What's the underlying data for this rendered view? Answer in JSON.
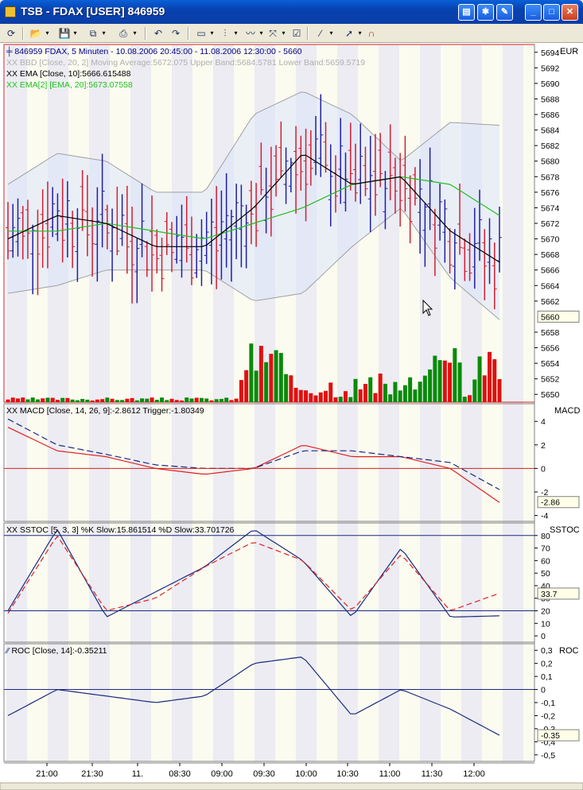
{
  "window": {
    "title": "TSB - FDAX [USER] 846959"
  },
  "panels": {
    "price": {
      "header": "846959  FDAX, 5 Minuten - 10.08.2006 20:45:00 - 11.08.2006 12:30:00 - 5660",
      "bbd": "XX BBD [Close, 20, 2] Moving Average:5672.075 Upper Band:5684.5781 Lower Band:5659.5719",
      "ema": "XX EMA [Close, 10]:5666.615488",
      "ema2": "XX EMA[2] [EMA, 20]:5673.07558",
      "right_label": "EUR",
      "last_value": "5660",
      "ticks": [
        "5694",
        "5692",
        "5690",
        "5688",
        "5686",
        "5684",
        "5682",
        "5680",
        "5678",
        "5676",
        "5674",
        "5672",
        "5670",
        "5668",
        "5666",
        "5664",
        "5662",
        "5658",
        "5656",
        "5654",
        "5652",
        "5650"
      ]
    },
    "macd": {
      "header": "XX MACD [Close, 14, 26, 9]:-2.8612 Trigger:-1.80349",
      "right_label": "MACD",
      "last_value": "-2.86",
      "ticks": [
        "4",
        "2",
        "0",
        "-2",
        "-4"
      ]
    },
    "sstoc": {
      "header": "XX SSTOC [5, 3, 3] %K Slow:15.861514 %D Slow:33.701726",
      "right_label": "SSTOC",
      "last_value": "33.7",
      "ticks": [
        "80",
        "70",
        "60",
        "50",
        "40",
        "30",
        "20",
        "10",
        "0"
      ]
    },
    "roc": {
      "header": "ROC [Close, 14]:-0.35211",
      "right_label": "ROC",
      "last_value": "-0.35",
      "ticks": [
        "0,3",
        "0,2",
        "0,1",
        "0",
        "-0,1",
        "-0,2",
        "-0,3",
        "-0,4",
        "-0,5"
      ]
    }
  },
  "time_axis": [
    "21:00",
    "21:30",
    "11.",
    "08:30",
    "09:00",
    "09:30",
    "10:00",
    "10:30",
    "11:00",
    "11:30",
    "12:00"
  ],
  "colors": {
    "up_candle": "#2020a0",
    "down_candle": "#d02030",
    "ema": "#000000",
    "ema2": "#20c020",
    "band": "#a0a0a0",
    "macd_line": "#e02020",
    "macd_trigger": "#1a2a80",
    "stoch_k": "#1a2a80",
    "stoch_d": "#e02020",
    "roc_line": "#1a2a80",
    "volume_up": "#0a8a0a",
    "volume_down": "#e01010"
  },
  "chart_data": [
    {
      "type": "line",
      "title": "846959  FDAX, 5 Minuten - 10.08.2006 20:45:00 - 11.08.2006 12:30:00 - 5660",
      "ylabel": "EUR",
      "ylim": [
        5649,
        5695
      ],
      "x": [
        "21:00",
        "21:30",
        "11.",
        "08:30",
        "09:00",
        "09:30",
        "10:00",
        "10:30",
        "11:00",
        "11:30",
        "12:00"
      ],
      "series": [
        {
          "name": "XX EMA [Close, 10]",
          "values": [
            5670,
            5673,
            5672,
            5669,
            5669,
            5674,
            5681,
            5677,
            5678,
            5671,
            5667
          ]
        },
        {
          "name": "XX EMA[2] [EMA, 20]",
          "values": [
            5671,
            5671,
            5672,
            5671,
            5670,
            5672,
            5674,
            5677,
            5678,
            5677,
            5673
          ]
        },
        {
          "name": "XX BBD Upper Band",
          "values": [
            5677,
            5681,
            5680,
            5676,
            5676,
            5686,
            5689,
            5686,
            5680,
            5685,
            5684.6
          ]
        },
        {
          "name": "XX BBD Lower Band",
          "values": [
            5663,
            5664,
            5666,
            5666,
            5666,
            5662,
            5663,
            5669,
            5674,
            5665,
            5659.6
          ]
        }
      ],
      "volume": [
        1,
        1,
        1,
        1,
        1,
        1,
        1,
        1,
        1,
        1,
        1,
        1,
        1,
        1,
        1,
        1,
        1,
        1,
        1,
        1,
        1,
        1,
        1,
        1,
        1,
        1,
        1,
        1,
        1,
        1,
        1,
        1,
        1,
        1,
        1,
        1,
        1,
        1,
        1,
        1,
        1,
        1,
        1,
        1,
        1,
        1,
        1,
        3,
        3,
        3,
        3,
        3,
        3,
        3,
        3,
        3,
        3,
        3,
        3,
        3,
        3,
        3,
        3,
        3,
        3,
        3,
        3,
        3,
        3,
        3,
        3,
        3,
        3,
        3,
        3,
        3,
        3,
        3,
        3,
        3,
        3,
        3,
        3,
        3,
        3,
        3,
        3,
        3,
        3,
        3,
        3,
        3,
        3,
        3,
        3,
        3,
        3,
        3,
        3,
        3
      ]
    },
    {
      "type": "line",
      "title": "XX MACD [Close, 14, 26, 9]:-2.8612 Trigger:-1.80349",
      "ylim": [
        -4.5,
        5.5
      ],
      "x": [
        "21:00",
        "21:30",
        "11.",
        "08:30",
        "09:00",
        "09:30",
        "10:00",
        "10:30",
        "11:00",
        "11:30",
        "12:00"
      ],
      "series": [
        {
          "name": "XX MACD",
          "values": [
            3.5,
            1.5,
            1.0,
            0,
            -0.5,
            0,
            2.0,
            1.0,
            1.0,
            0,
            -2.9
          ]
        },
        {
          "name": "Trigger",
          "values": [
            4.2,
            2.0,
            1.2,
            0.3,
            0,
            0,
            1.5,
            1.5,
            1.0,
            0.5,
            -1.8
          ]
        }
      ]
    },
    {
      "type": "line",
      "title": "XX SSTOC [5, 3, 3] %K Slow:15.861514 %D Slow:33.701726",
      "ylim": [
        -5,
        90
      ],
      "x": [
        "21:00",
        "21:30",
        "11.",
        "08:30",
        "09:00",
        "09:30",
        "10:00",
        "10:30",
        "11:00",
        "11:30",
        "12:00"
      ],
      "series": [
        {
          "name": "%K Slow",
          "values": [
            20,
            85,
            15,
            35,
            55,
            85,
            60,
            15,
            70,
            15,
            16
          ]
        },
        {
          "name": "%D Slow",
          "values": [
            18,
            80,
            20,
            30,
            55,
            75,
            60,
            20,
            65,
            20,
            34
          ]
        }
      ]
    },
    {
      "type": "line",
      "title": "ROC [Close, 14]:-0.35211",
      "ylim": [
        -0.55,
        0.35
      ],
      "x": [
        "21:00",
        "21:30",
        "11.",
        "08:30",
        "09:00",
        "09:30",
        "10:00",
        "10:30",
        "11:00",
        "11:30",
        "12:00"
      ],
      "series": [
        {
          "name": "ROC",
          "values": [
            -0.2,
            0,
            -0.05,
            -0.1,
            -0.05,
            0.2,
            0.25,
            -0.2,
            0,
            -0.15,
            -0.35
          ]
        }
      ]
    }
  ]
}
